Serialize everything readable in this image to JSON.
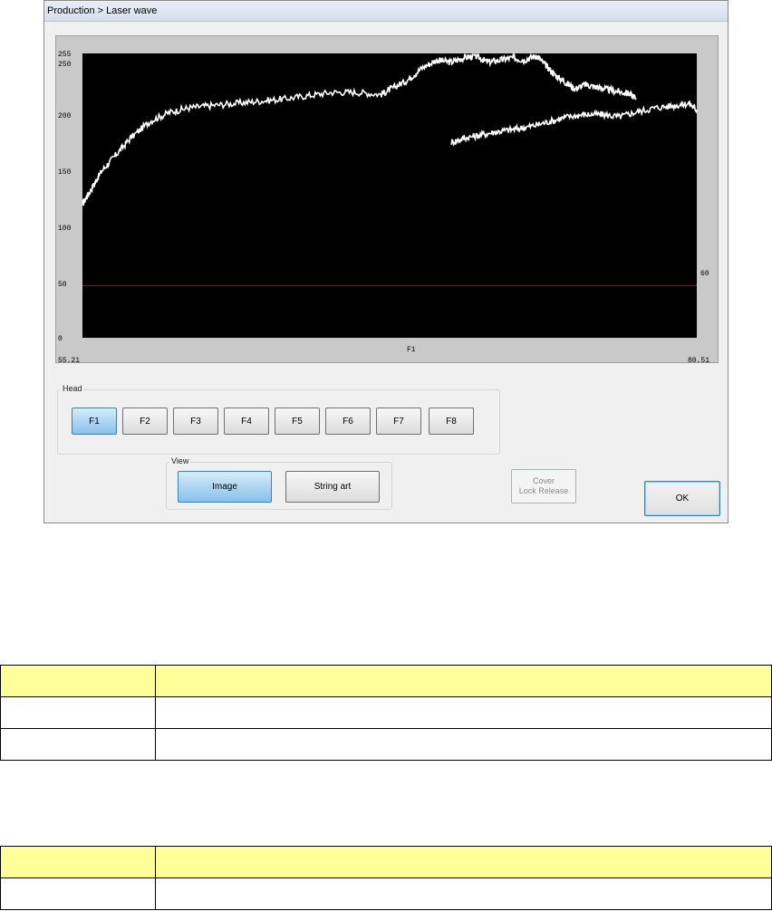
{
  "window": {
    "title": "Production > Laser wave"
  },
  "plot": {
    "y_ticks": [
      "255",
      "250",
      "200",
      "150",
      "100",
      "50",
      "0"
    ],
    "x_start": "55.21",
    "x_end": "80.51",
    "channel_label": "F1",
    "threshold_label": "60",
    "ylim": [
      0,
      256
    ],
    "threshold_value": 47,
    "colors": {
      "background": "#000000",
      "trace": "#ffffff",
      "threshold": "#d10000",
      "panel": "#c9c9c9"
    }
  },
  "chart_data": {
    "type": "line",
    "xlim": [
      55.21,
      80.51
    ],
    "ylim": [
      0,
      256
    ],
    "series": [
      {
        "x": [
          55.21,
          55.6,
          56.0,
          56.6,
          57.2,
          58.0,
          58.8,
          59.6,
          60.5,
          61.5,
          62.5,
          63.5,
          64.5,
          65.5,
          66.5,
          67.5,
          68.0,
          68.6,
          69.2,
          69.8,
          70.4,
          70.9,
          71.4,
          71.9,
          72.4,
          72.9,
          73.4,
          73.9,
          74.3,
          74.7,
          75.1,
          75.5,
          75.9,
          76.3,
          76.7,
          77.2,
          77.7,
          78.0
        ],
        "y": [
          120,
          135,
          150,
          165,
          180,
          195,
          203,
          207,
          209,
          211,
          213,
          215,
          218,
          221,
          221,
          219,
          225,
          232,
          243,
          250,
          248,
          252,
          254,
          248,
          250,
          252,
          250,
          254,
          245,
          236,
          230,
          224,
          228,
          226,
          224,
          222,
          220,
          216
        ]
      },
      {
        "x": [
          70.4,
          71.0,
          71.7,
          72.4,
          73.1,
          73.8,
          74.5,
          75.2,
          75.9,
          76.6,
          77.3,
          78.0,
          78.8,
          79.6,
          80.2,
          80.51
        ],
        "y": [
          176,
          180,
          183,
          186,
          188,
          191,
          195,
          199,
          201,
          201,
          199,
          203,
          207,
          209,
          211,
          205
        ]
      }
    ]
  },
  "head": {
    "label": "Head",
    "buttons": [
      "F1",
      "F2",
      "F3",
      "F4",
      "F5",
      "F6",
      "F7",
      "F8"
    ],
    "selected": 0
  },
  "view": {
    "label": "View",
    "image_label": "Image",
    "string_art_label": "String art"
  },
  "cover": {
    "line1": "Cover",
    "line2": "Lock Release"
  },
  "ok_label": "OK",
  "doc_table_color": "#ffff99"
}
